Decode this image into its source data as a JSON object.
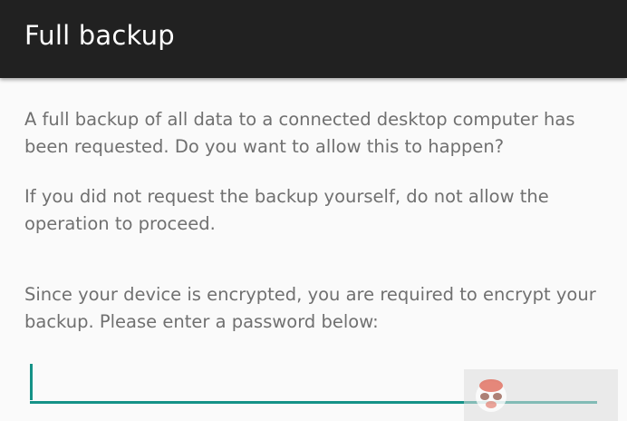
{
  "toolbar": {
    "title": "Full backup"
  },
  "message": {
    "paragraph1": "A full backup of all data to a connected desktop computer has been requested. Do you want to allow this to happen?",
    "paragraph2": "If you did not request the backup yourself, do not allow the operation to proceed.",
    "paragraph3": "Since your device is encrypted, you are required to encrypt your backup. Please enter a password below:"
  },
  "password_field": {
    "value": ""
  },
  "colors": {
    "toolbar_background": "#212121",
    "accent": "#159287",
    "body_text": "#707070",
    "page_background": "#fafafa"
  },
  "icons": {
    "watermark_logo": "mascot-logo"
  }
}
